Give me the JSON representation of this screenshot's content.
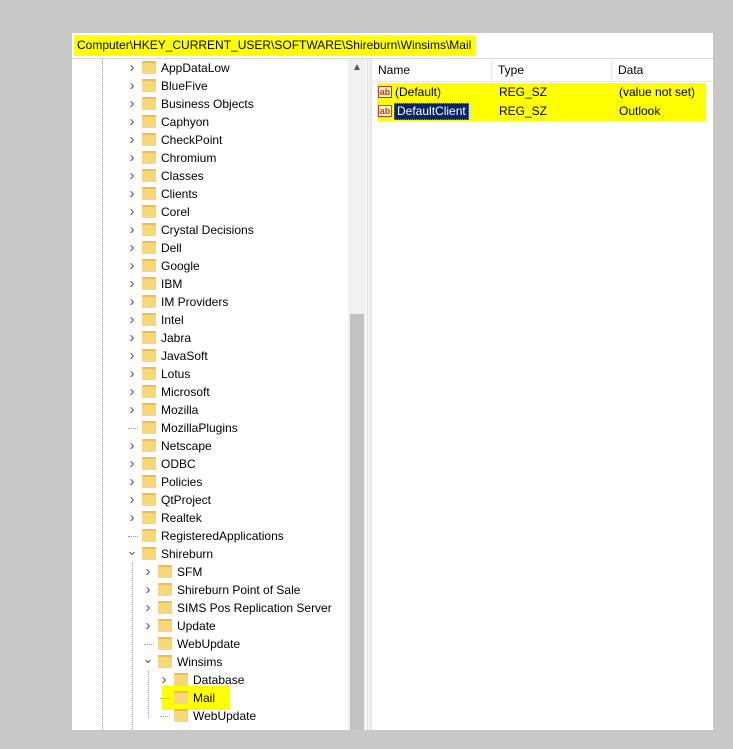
{
  "address": {
    "path": "Computer\\HKEY_CURRENT_USER\\SOFTWARE\\Shireburn\\Winsims\\Mail"
  },
  "tree": {
    "items": [
      {
        "label": "AppDataLow",
        "level": 1,
        "chevron": "right"
      },
      {
        "label": "BlueFive",
        "level": 1,
        "chevron": "right"
      },
      {
        "label": "Business Objects",
        "level": 1,
        "chevron": "right"
      },
      {
        "label": "Caphyon",
        "level": 1,
        "chevron": "right"
      },
      {
        "label": "CheckPoint",
        "level": 1,
        "chevron": "right"
      },
      {
        "label": "Chromium",
        "level": 1,
        "chevron": "right"
      },
      {
        "label": "Classes",
        "level": 1,
        "chevron": "right"
      },
      {
        "label": "Clients",
        "level": 1,
        "chevron": "right"
      },
      {
        "label": "Corel",
        "level": 1,
        "chevron": "right"
      },
      {
        "label": "Crystal Decisions",
        "level": 1,
        "chevron": "right"
      },
      {
        "label": "Dell",
        "level": 1,
        "chevron": "right"
      },
      {
        "label": "Google",
        "level": 1,
        "chevron": "right"
      },
      {
        "label": "IBM",
        "level": 1,
        "chevron": "right"
      },
      {
        "label": "IM Providers",
        "level": 1,
        "chevron": "right"
      },
      {
        "label": "Intel",
        "level": 1,
        "chevron": "right"
      },
      {
        "label": "Jabra",
        "level": 1,
        "chevron": "right"
      },
      {
        "label": "JavaSoft",
        "level": 1,
        "chevron": "right"
      },
      {
        "label": "Lotus",
        "level": 1,
        "chevron": "right"
      },
      {
        "label": "Microsoft",
        "level": 1,
        "chevron": "right"
      },
      {
        "label": "Mozilla",
        "level": 1,
        "chevron": "right"
      },
      {
        "label": "MozillaPlugins",
        "level": 1,
        "chevron": "none"
      },
      {
        "label": "Netscape",
        "level": 1,
        "chevron": "right"
      },
      {
        "label": "ODBC",
        "level": 1,
        "chevron": "right"
      },
      {
        "label": "Policies",
        "level": 1,
        "chevron": "right"
      },
      {
        "label": "QtProject",
        "level": 1,
        "chevron": "right"
      },
      {
        "label": "Realtek",
        "level": 1,
        "chevron": "right"
      },
      {
        "label": "RegisteredApplications",
        "level": 1,
        "chevron": "none"
      },
      {
        "label": "Shireburn",
        "level": 1,
        "chevron": "down"
      },
      {
        "label": "SFM",
        "level": 2,
        "chevron": "right"
      },
      {
        "label": "Shireburn Point of Sale",
        "level": 2,
        "chevron": "right"
      },
      {
        "label": "SIMS Pos Replication Server",
        "level": 2,
        "chevron": "right"
      },
      {
        "label": "Update",
        "level": 2,
        "chevron": "right"
      },
      {
        "label": "WebUpdate",
        "level": 2,
        "chevron": "none"
      },
      {
        "label": "Winsims",
        "level": 2,
        "chevron": "down"
      },
      {
        "label": "Database",
        "level": 3,
        "chevron": "right"
      },
      {
        "label": "Mail",
        "level": 3,
        "chevron": "none",
        "selected": true
      },
      {
        "label": "WebUpdate",
        "level": 3,
        "chevron": "none"
      }
    ]
  },
  "list": {
    "columns": [
      "Name",
      "Type",
      "Data"
    ],
    "rows": [
      {
        "icon": "string-value-icon",
        "icon_text": "ab",
        "name": "(Default)",
        "type": "REG_SZ",
        "data": "(value not set)",
        "selected": false
      },
      {
        "icon": "string-value-icon",
        "icon_text": "ab",
        "name": "DefaultClient",
        "type": "REG_SZ",
        "data": "Outlook",
        "selected": true
      }
    ]
  },
  "colors": {
    "highlight": "#ffff00",
    "folder": "#f7d67c",
    "selection": "#0a246a"
  }
}
